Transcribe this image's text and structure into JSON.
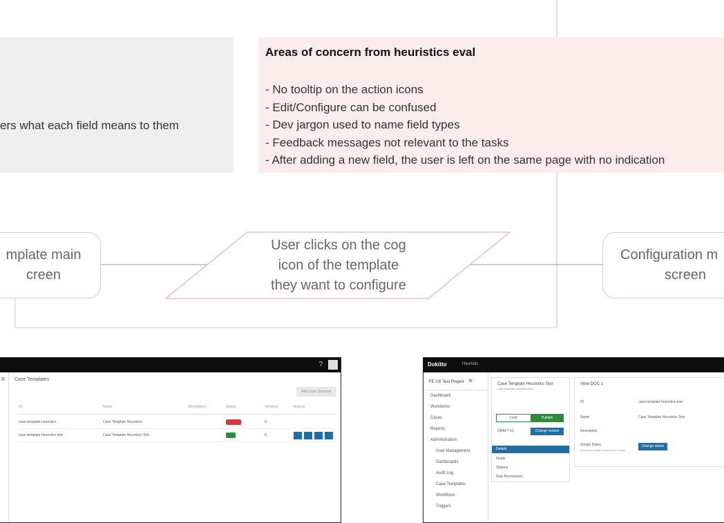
{
  "notes": {
    "gray_text": "ers what each field means to them",
    "concern_title": "Areas of concern from heuristics eval",
    "concern_items": [
      "- No tooltip on the action icons",
      "- Edit/Configure can be confused",
      "- Dev jargon used to name field types",
      "- Feedback messages not relevant to the tasks",
      "- After adding a new field, the user is left on the same page with no indication"
    ]
  },
  "flow": {
    "left_node": [
      "mplate main",
      "creen"
    ],
    "decision": [
      "User clicks on the cog",
      "icon of the template",
      "they want to configure"
    ],
    "right_node": [
      "Configuration m",
      "screen"
    ]
  },
  "shot_left": {
    "page_title": "Case Templates",
    "add_button": "Add Case Template",
    "columns": [
      "ID",
      "Name",
      "Description",
      "Status",
      "Versions",
      "Actions"
    ],
    "rows": [
      {
        "id": "case-template-heuristics",
        "name": "Case Template Heuristics",
        "version": "0"
      },
      {
        "id": "case-template-heuristics-test",
        "name": "Case Template Heuristics Test",
        "version": "0"
      }
    ]
  },
  "shot_right": {
    "brand": "Dokitto",
    "crumb": "Heuristic",
    "project": "FE UX Test Project",
    "sidebar": [
      "Dashboard",
      "Workitems",
      "Cases",
      "Reports",
      "Administration",
      "User Management",
      "Dashboards",
      "Audit Log",
      "Case Templates",
      "Workflows",
      "Triggers"
    ],
    "card_title": "Case Template Heuristics Test",
    "card_sub": "case-template-heuristics-test",
    "toggle_left": "Draft",
    "toggle_right": "Publish",
    "version_label": "DRAFT V1",
    "version_button": "Change version",
    "tabs": [
      "Details",
      "Fields",
      "Options",
      "Role Permissions"
    ],
    "panel_title": "View DOC 1",
    "panel_rows": [
      {
        "label": "ID",
        "value": "case-template-heuristics-test"
      },
      {
        "label": "Name",
        "value": "Case Template Heuristics Test"
      },
      {
        "label": "Description",
        "value": ""
      },
      {
        "label": "Simple Dates",
        "value": ""
      }
    ],
    "panel_note": "Determines date format used in case",
    "panel_button": "Change status"
  },
  "colors": {
    "pink_note": "#fdecec",
    "gray_note": "#efefef",
    "accent_blue": "#1d6fa5",
    "green": "#2e8b3a",
    "red": "#d9363e"
  }
}
